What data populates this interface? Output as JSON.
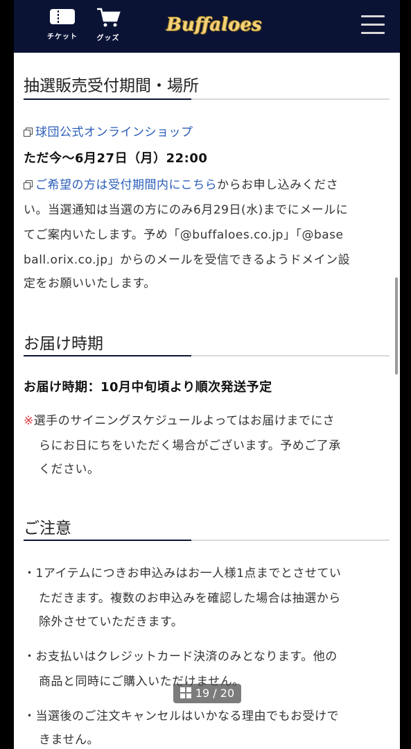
{
  "header": {
    "ticket_label": "チケット",
    "goods_label": "グッズ",
    "logo_text": "Buffaloes"
  },
  "sections": {
    "period": {
      "heading": "抽選販売受付期間・場所",
      "shop_link": "球団公式オンラインショップ",
      "period_text": "ただ今〜6月27日（月）22:00",
      "apply_link": "ご希望の方は受付期間内にこちら",
      "lines": [
        "からお申し込みくださ",
        "い。当選通知は当選の方にのみ6月29日(水)までにメールに",
        "てご案内いたします。予め「@buffaloes.co.jp」「@base",
        "ball.orix.co.jp」からのメールを受信できるようドメイン設",
        "定をお願いいたします。"
      ]
    },
    "delivery": {
      "heading": "お届け時期",
      "bold_text": "お届け時期：10月中旬頃より順次発送予定",
      "note_mark": "※",
      "note_lines": [
        "選手のサイニングスケジュールよってはお届けまでにさ",
        "らにお日にちをいただく場合がございます。予めご了承",
        "ください。"
      ]
    },
    "caution": {
      "heading": "ご注意",
      "bullet": "・",
      "items": [
        [
          "1アイテムにつきお申込みはお一人様1点までとさせてい",
          "ただきます。複数のお申込みを確認した場合は抽選から",
          "除外させていただきます。"
        ],
        [
          "お支払いはクレジットカード決済のみとなります。他の",
          "商品と同時にご購入いただけません。"
        ],
        [
          "当選後のご注文キャンセルはいかなる理由でもお受けで",
          "きません。"
        ]
      ]
    }
  },
  "pager": {
    "text": "19 / 20"
  }
}
